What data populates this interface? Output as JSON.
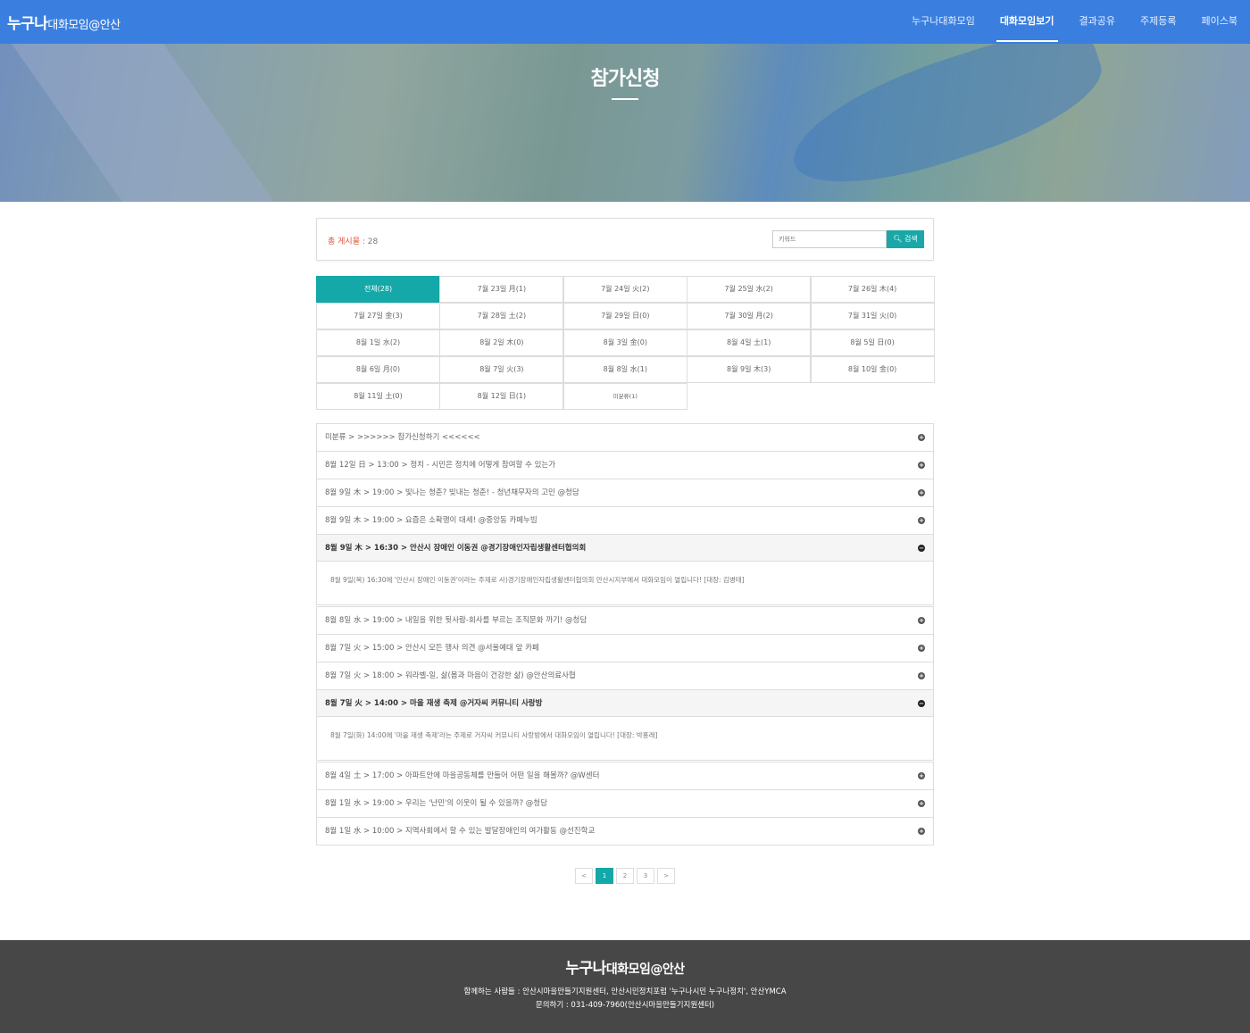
{
  "header": {
    "logo_main": "누구나",
    "logo_sub": "대화모임@안산",
    "nav": [
      "누구나대화모임",
      "대화모임보기",
      "결과공유",
      "주제등록",
      "페이스북"
    ],
    "active_nav": 1
  },
  "hero": {
    "title": "참가신청"
  },
  "search": {
    "count_label": "총 게시물 : ",
    "count_value": "28",
    "placeholder": "키워드",
    "button_label": "검색"
  },
  "dates": [
    "전체(28)",
    "7월 23일 月(1)",
    "7월 24일 火(2)",
    "7월 25일 水(2)",
    "7월 26일 木(4)",
    "7월 27일 金(3)",
    "7월 28일 土(2)",
    "7월 29일 日(0)",
    "7월 30일 月(2)",
    "7월 31일 火(0)",
    "8월 1일 水(2)",
    "8월 2일 木(0)",
    "8월 3일 金(0)",
    "8월 4일 土(1)",
    "8월 5일 日(0)",
    "8월 6일 月(0)",
    "8월 7일 火(3)",
    "8월 8일 水(1)",
    "8월 9일 木(3)",
    "8월 10일 金(0)",
    "8월 11일 土(0)",
    "8월 12일 日(1)",
    "미분류(1)"
  ],
  "items": [
    {
      "title": "미분류 > >>>>>> 참가신청하기 <<<<<<",
      "open": false
    },
    {
      "title": "8월 12일 日 > 13:00 > 정치 - 시민은 정치에 어떻게 참여할 수 있는가",
      "open": false
    },
    {
      "title": "8월 9일 木 > 19:00 > 빛나는 청춘? 빚내는 청춘! - 청년채무자의 고민 @청담",
      "open": false
    },
    {
      "title": "8월 9일 木 > 19:00 > 요즘은 소확행이 대세! @중앙동 카페누빔",
      "open": false
    },
    {
      "title": "8월 9일 木 > 16:30 > 안산시 장애인 이동권 @경기장애인자립생활센터협의회",
      "open": true,
      "body": "8월 9일(목) 16:30에 '안산시 장애인 이동권'이라는 주제로 사)경기장애인자립생활센터협의회 안산시지부에서 대화모임이 열립니다! [대장: 김병태]"
    },
    {
      "title": "8월 8일 水 > 19:00 > 내일을 위한 뒷사람-회사를 부르는 조직문화 까기! @청담",
      "open": false
    },
    {
      "title": "8월 7일 火 > 15:00 > 안산시 모든 행사 의견 @서울예대 앞 카페",
      "open": false
    },
    {
      "title": "8월 7일 火 > 18:00 > 워라벨-일, 삶(몸과 마음이 건강한 삶) @안산의료사협",
      "open": false
    },
    {
      "title": "8월 7일 火 > 14:00 > 마을 재생 축제 @거자씨 커뮤니티 사랑방",
      "open": true,
      "body": "8월 7일(화) 14:00에 '마을 재생 축제'라는 주제로 거자씨 커뮤니티 사랑방에서 대화모임이 열립니다! [대장: 박홍래]"
    },
    {
      "title": "8월 4일 土 > 17:00 > 아파트안에 마을공동체를 만들어 어떤 일을 해볼까? @W센터",
      "open": false
    },
    {
      "title": "8월 1일 水 > 19:00 > 우리는 '난민'의 이웃이 될 수 있을까? @청담",
      "open": false
    },
    {
      "title": "8월 1일 水 > 10:00 > 지역사회에서 할 수 있는 발달장애인의 여가활동 @선진학교",
      "open": false
    }
  ],
  "pager": [
    "<",
    "1",
    "2",
    "3",
    ">"
  ],
  "pager_active": 1,
  "footer": {
    "logo_main": "누구나",
    "logo_sub": "대화모임@안산",
    "line1": "함께하는 사람들 : 안산시마을만들기지원센터, 안산시민정치포럼 '누구나시민 누구나정치', 안산YMCA",
    "line2": "문의하기 : 031-409-7960(안산시마을만들기지원센터)"
  }
}
